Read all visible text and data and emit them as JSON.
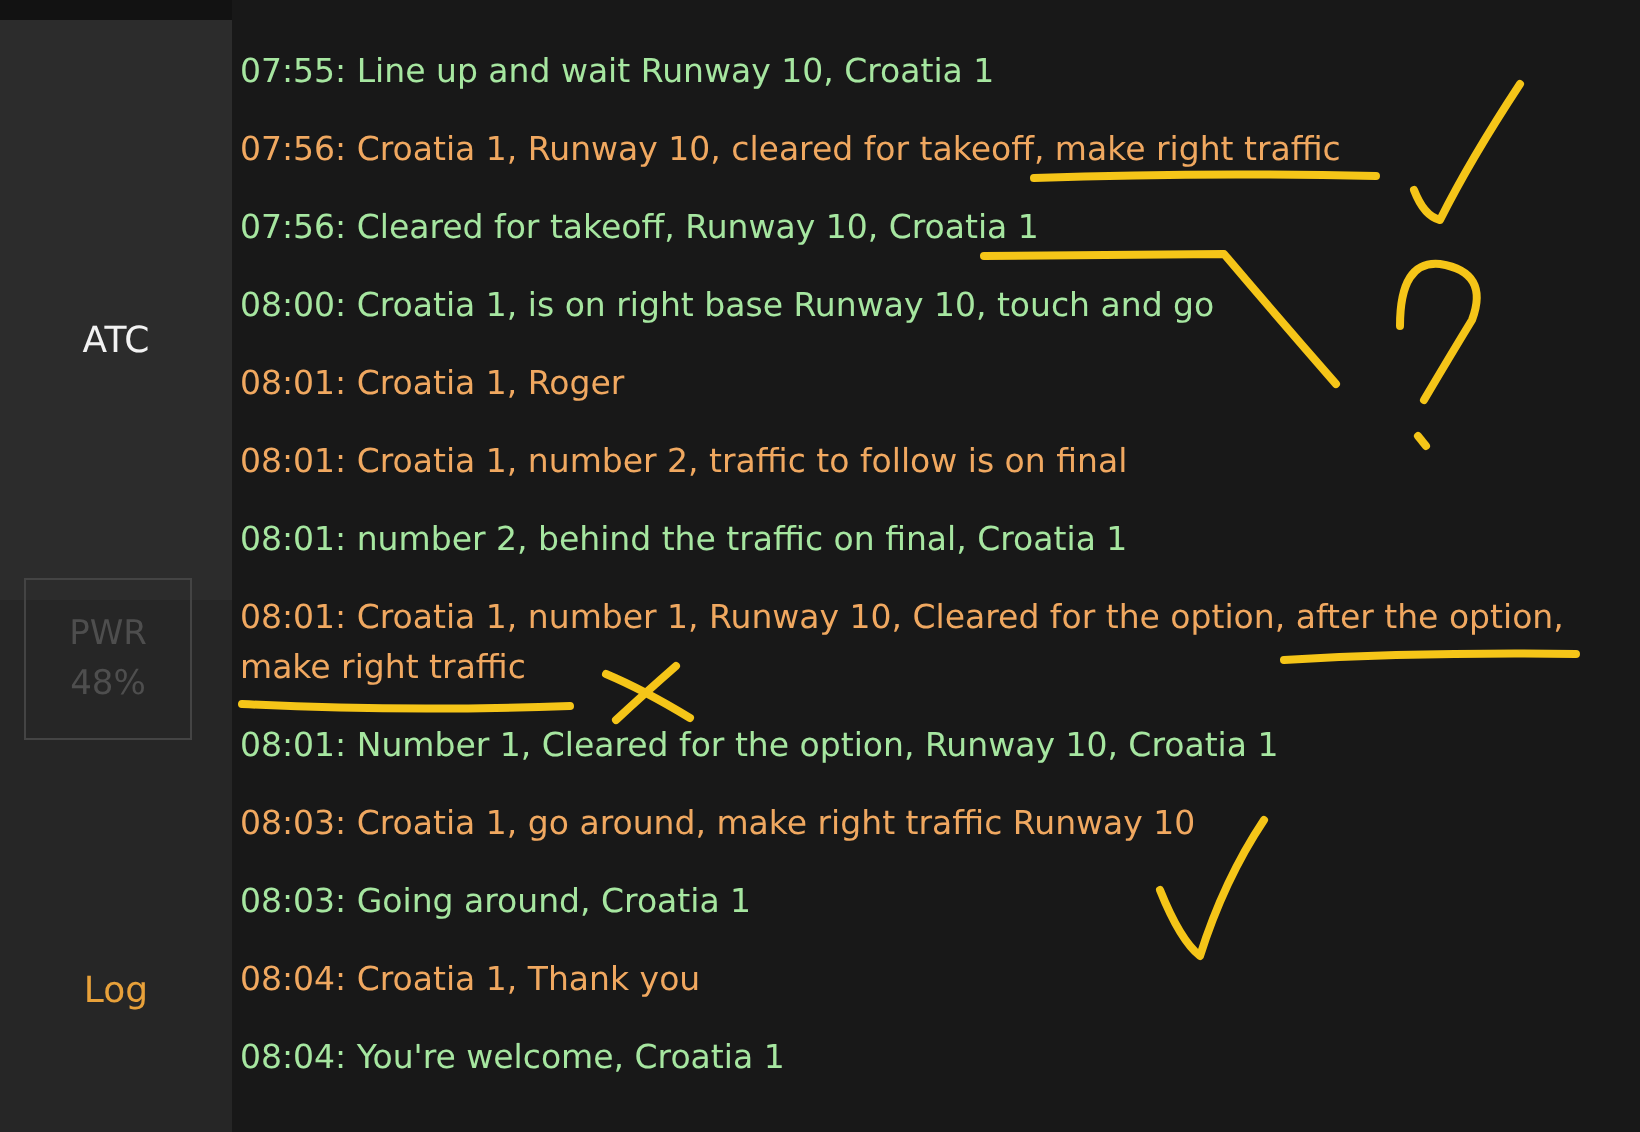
{
  "sidebar": {
    "items": [
      {
        "label": "ATC",
        "kind": "title"
      },
      {
        "label": "PWR",
        "value": "48%",
        "kind": "gauge"
      },
      {
        "label": "Log",
        "kind": "link"
      }
    ]
  },
  "log": {
    "entries": [
      {
        "text": "07:55: Line up and wait Runway 10, Croatia 1",
        "kind": "pilot"
      },
      {
        "text": "07:56: Croatia 1, Runway 10, cleared for takeoff, make right traffic",
        "kind": "atc"
      },
      {
        "text": "07:56: Cleared for takeoff, Runway 10, Croatia 1",
        "kind": "pilot"
      },
      {
        "text": "08:00: Croatia 1, is on right base Runway 10, touch and go",
        "kind": "pilot"
      },
      {
        "text": "08:01: Croatia 1, Roger",
        "kind": "atc"
      },
      {
        "text": "08:01: Croatia 1, number 2, traffic to follow is on final",
        "kind": "atc"
      },
      {
        "text": "08:01: number 2, behind the traffic on final, Croatia 1",
        "kind": "pilot"
      },
      {
        "text": "08:01: Croatia 1, number 1, Runway 10, Cleared for the option, after the option, make right traffic",
        "kind": "atc"
      },
      {
        "text": "08:01: Number 1, Cleared for the option, Runway 10, Croatia 1",
        "kind": "pilot"
      },
      {
        "text": "08:03: Croatia 1, go around, make right traffic Runway 10",
        "kind": "atc"
      },
      {
        "text": "08:03: Going around, Croatia 1",
        "kind": "pilot"
      },
      {
        "text": "08:04: Croatia 1, Thank you",
        "kind": "atc"
      },
      {
        "text": "08:04: You're welcome, Croatia 1",
        "kind": "pilot"
      }
    ]
  }
}
